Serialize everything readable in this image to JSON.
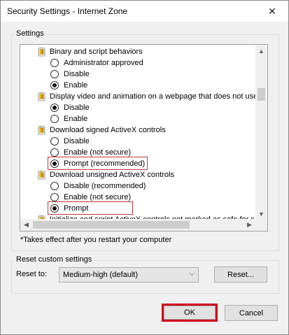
{
  "window": {
    "title": "Security Settings - Internet Zone",
    "close_icon": "close-icon"
  },
  "settings_group": {
    "label": "Settings"
  },
  "settings_list": [
    {
      "type": "category",
      "label": "Binary and script behaviors"
    },
    {
      "type": "option",
      "label": "Administrator approved",
      "checked": false
    },
    {
      "type": "option",
      "label": "Disable",
      "checked": false
    },
    {
      "type": "option",
      "label": "Enable",
      "checked": true
    },
    {
      "type": "category",
      "label": "Display video and animation on a webpage that does not use"
    },
    {
      "type": "option",
      "label": "Disable",
      "checked": true
    },
    {
      "type": "option",
      "label": "Enable",
      "checked": false
    },
    {
      "type": "category",
      "label": "Download signed ActiveX controls"
    },
    {
      "type": "option",
      "label": "Disable",
      "checked": false
    },
    {
      "type": "option",
      "label": "Enable (not secure)",
      "checked": false
    },
    {
      "type": "option",
      "label": "Prompt (recommended)",
      "checked": true,
      "highlighted": true
    },
    {
      "type": "category",
      "label": "Download unsigned ActiveX controls"
    },
    {
      "type": "option",
      "label": "Disable (recommended)",
      "checked": false
    },
    {
      "type": "option",
      "label": "Enable (not secure)",
      "checked": false
    },
    {
      "type": "option",
      "label": "Prompt",
      "checked": true,
      "highlighted": true
    },
    {
      "type": "category",
      "label": "Initialize and script ActiveX controls not marked as safe for s"
    }
  ],
  "note": "*Takes effect after you restart your computer",
  "reset_group": {
    "label": "Reset custom settings",
    "reset_to_label": "Reset to:",
    "selected_level": "Medium-high (default)",
    "reset_button": "Reset..."
  },
  "buttons": {
    "ok": "OK",
    "cancel": "Cancel"
  },
  "colors": {
    "highlight": "#c0393b",
    "ok_outline": "#d0021b"
  }
}
